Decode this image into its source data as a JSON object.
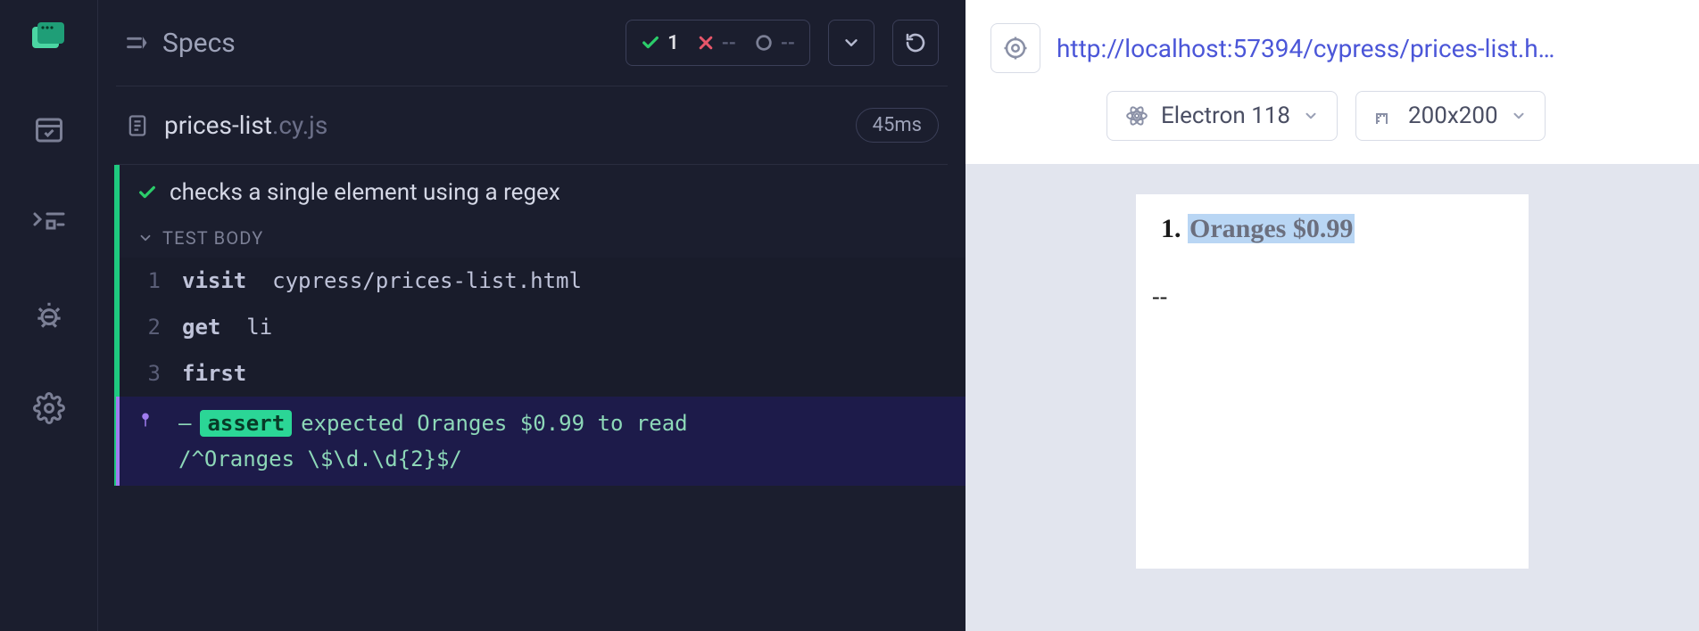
{
  "header": {
    "title": "Specs",
    "stats": {
      "passed": "1",
      "failed": "--",
      "pending": "--"
    }
  },
  "spec": {
    "name": "prices-list",
    "ext": ".cy.js",
    "duration": "45ms"
  },
  "test": {
    "title": "checks a single element using a regex",
    "body_label": "TEST BODY",
    "commands": [
      {
        "n": "1",
        "name": "visit",
        "arg": "cypress/prices-list.html"
      },
      {
        "n": "2",
        "name": "get",
        "arg": "li"
      },
      {
        "n": "3",
        "name": "first",
        "arg": ""
      }
    ],
    "assert": {
      "dash": "–",
      "badge": "assert",
      "line1": "expected Oranges $0.99 to read",
      "line2": "/^Oranges \\$\\d.\\d{2}$/"
    }
  },
  "aut": {
    "url": "http://localhost:57394/cypress/prices-list.h…",
    "browser": "Electron 118",
    "viewport": "200x200",
    "list_item": "Oranges $0.99",
    "list_index": "1.",
    "extra": "--"
  }
}
